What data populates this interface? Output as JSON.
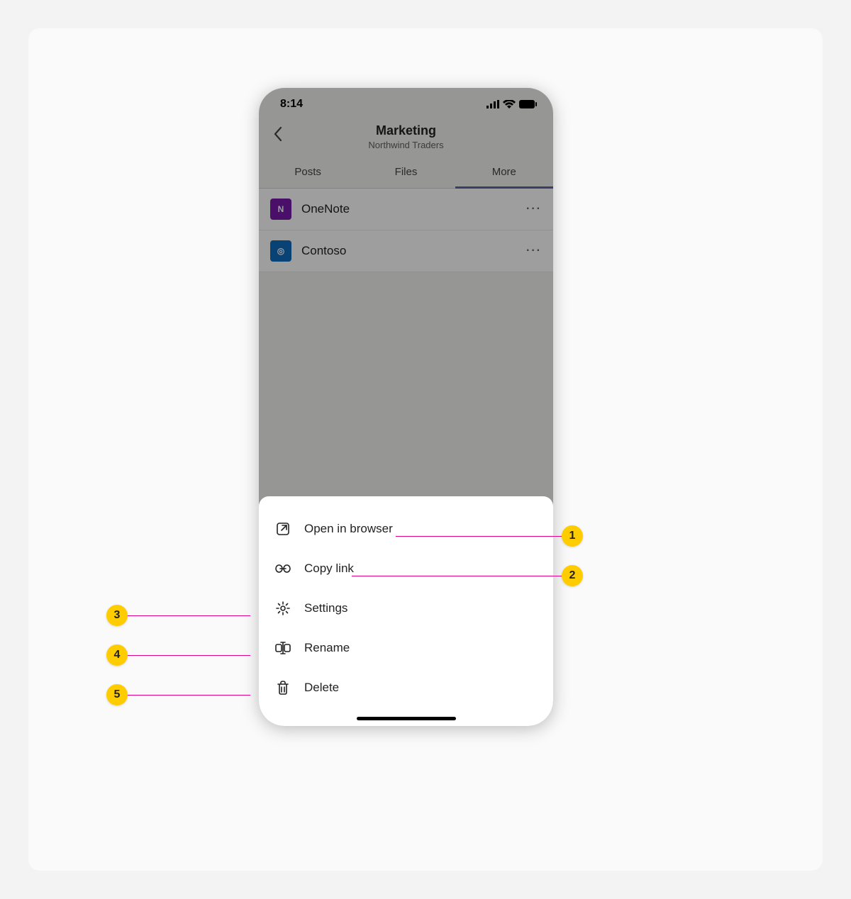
{
  "status": {
    "time": "8:14"
  },
  "header": {
    "title": "Marketing",
    "subtitle": "Northwind Traders"
  },
  "tabs": [
    {
      "label": "Posts",
      "active": false
    },
    {
      "label": "Files",
      "active": false
    },
    {
      "label": "More",
      "active": true
    }
  ],
  "apps": [
    {
      "name": "OneNote",
      "glyph": "N",
      "icon_class": "onenote"
    },
    {
      "name": "Contoso",
      "glyph": "◎",
      "icon_class": "contoso"
    }
  ],
  "sheet": [
    {
      "id": "open-in-browser",
      "label": "Open in browser"
    },
    {
      "id": "copy-link",
      "label": "Copy link"
    },
    {
      "id": "settings",
      "label": "Settings"
    },
    {
      "id": "rename",
      "label": "Rename"
    },
    {
      "id": "delete",
      "label": "Delete"
    }
  ],
  "callouts": [
    {
      "num": "1",
      "target": "open-in-browser",
      "side": "right"
    },
    {
      "num": "2",
      "target": "copy-link",
      "side": "right"
    },
    {
      "num": "3",
      "target": "settings",
      "side": "left"
    },
    {
      "num": "4",
      "target": "rename",
      "side": "left"
    },
    {
      "num": "5",
      "target": "delete",
      "side": "left"
    }
  ],
  "colors": {
    "accent": "#6264a7",
    "callout": "#ffcc00",
    "leader": "#e3008c"
  }
}
